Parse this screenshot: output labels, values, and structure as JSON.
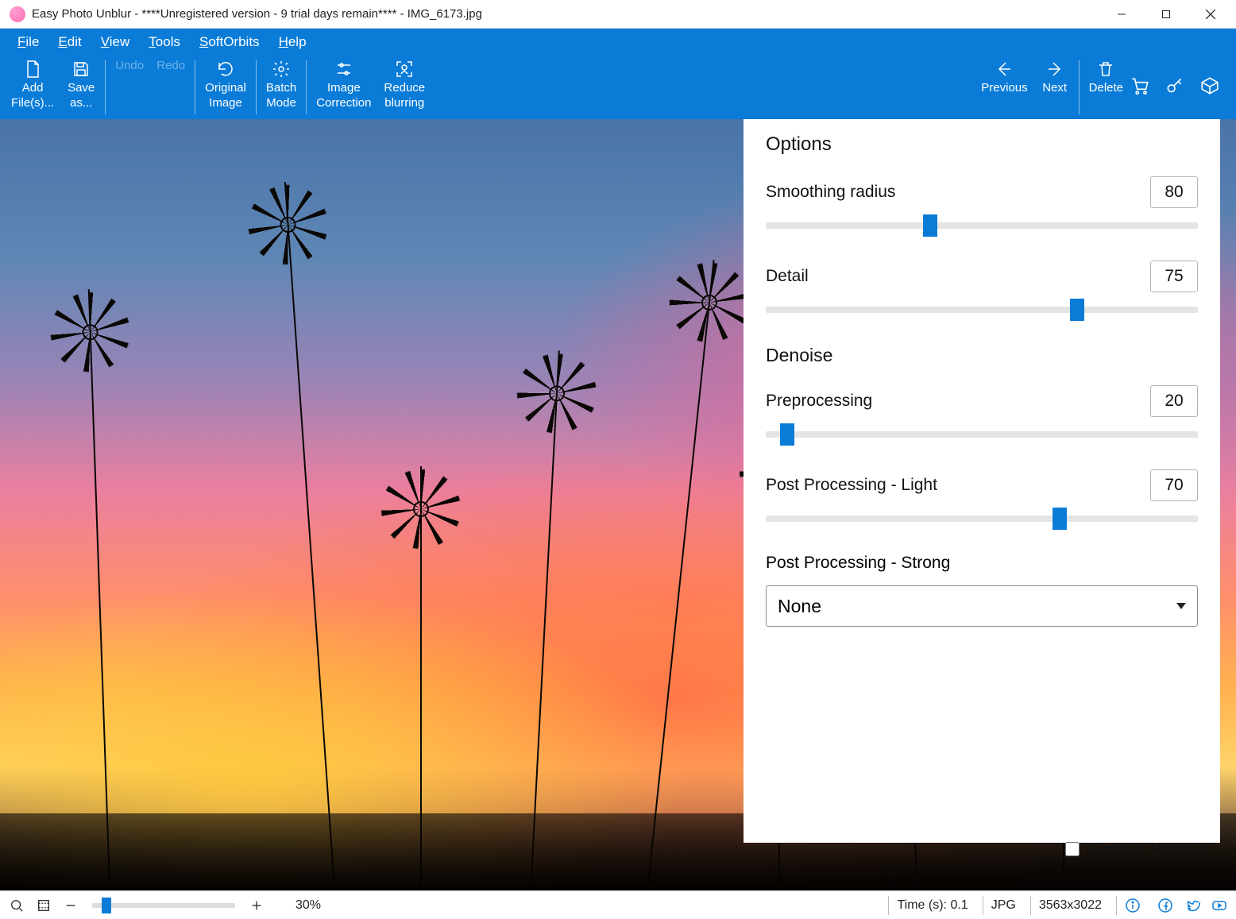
{
  "window": {
    "title": "Easy Photo Unblur - ****Unregistered version - 9 trial days remain**** - IMG_6173.jpg"
  },
  "menu": {
    "items": [
      "File",
      "Edit",
      "View",
      "Tools",
      "SoftOrbits",
      "Help"
    ]
  },
  "ribbon": {
    "add": "Add\nFile(s)...",
    "save": "Save\nas...",
    "undo": "Undo",
    "redo": "Redo",
    "original": "Original\nImage",
    "batch": "Batch\nMode",
    "correction": "Image\nCorrection",
    "reduce": "Reduce\nblurring",
    "previous": "Previous",
    "next": "Next",
    "delete": "Delete"
  },
  "options": {
    "heading": "Options",
    "smoothing_label": "Smoothing radius",
    "smoothing_value": "80",
    "smoothing_pct": 38,
    "detail_label": "Detail",
    "detail_value": "75",
    "detail_pct": 72,
    "denoise_heading": "Denoise",
    "preprocessing_label": "Preprocessing",
    "preprocessing_value": "20",
    "preprocessing_pct": 5,
    "postlight_label": "Post Processing - Light",
    "postlight_value": "70",
    "postlight_pct": 68,
    "poststrong_label": "Post Processing - Strong",
    "poststrong_value": "None",
    "normalize_label": "Normalize Histogram"
  },
  "status": {
    "zoom_pct": 10,
    "zoom_text": "30%",
    "time": "Time (s): 0.1",
    "format": "JPG",
    "dims": "3563x3022"
  }
}
